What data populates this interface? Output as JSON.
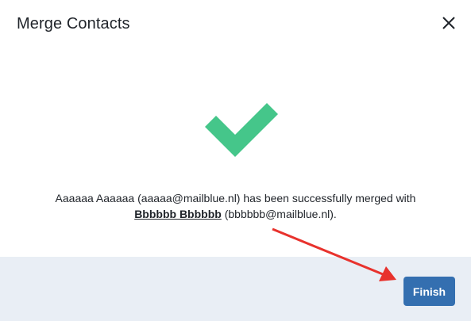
{
  "dialog": {
    "title": "Merge Contacts",
    "close_icon": "close-icon"
  },
  "success": {
    "icon": "checkmark-icon",
    "icon_color": "#45c68a",
    "message_prefix": "Aaaaaa Aaaaaa (aaaaa@mailblue.nl) has been successfully merged with",
    "merged_name": "Bbbbbb Bbbbbb",
    "merged_email": " (bbbbbb@mailblue.nl)."
  },
  "footer": {
    "finish_label": "Finish",
    "button_color": "#346fb0",
    "background_color": "#e9eef5"
  },
  "annotation": {
    "arrow_color": "#e8322d",
    "icon": "arrow-annotation"
  }
}
